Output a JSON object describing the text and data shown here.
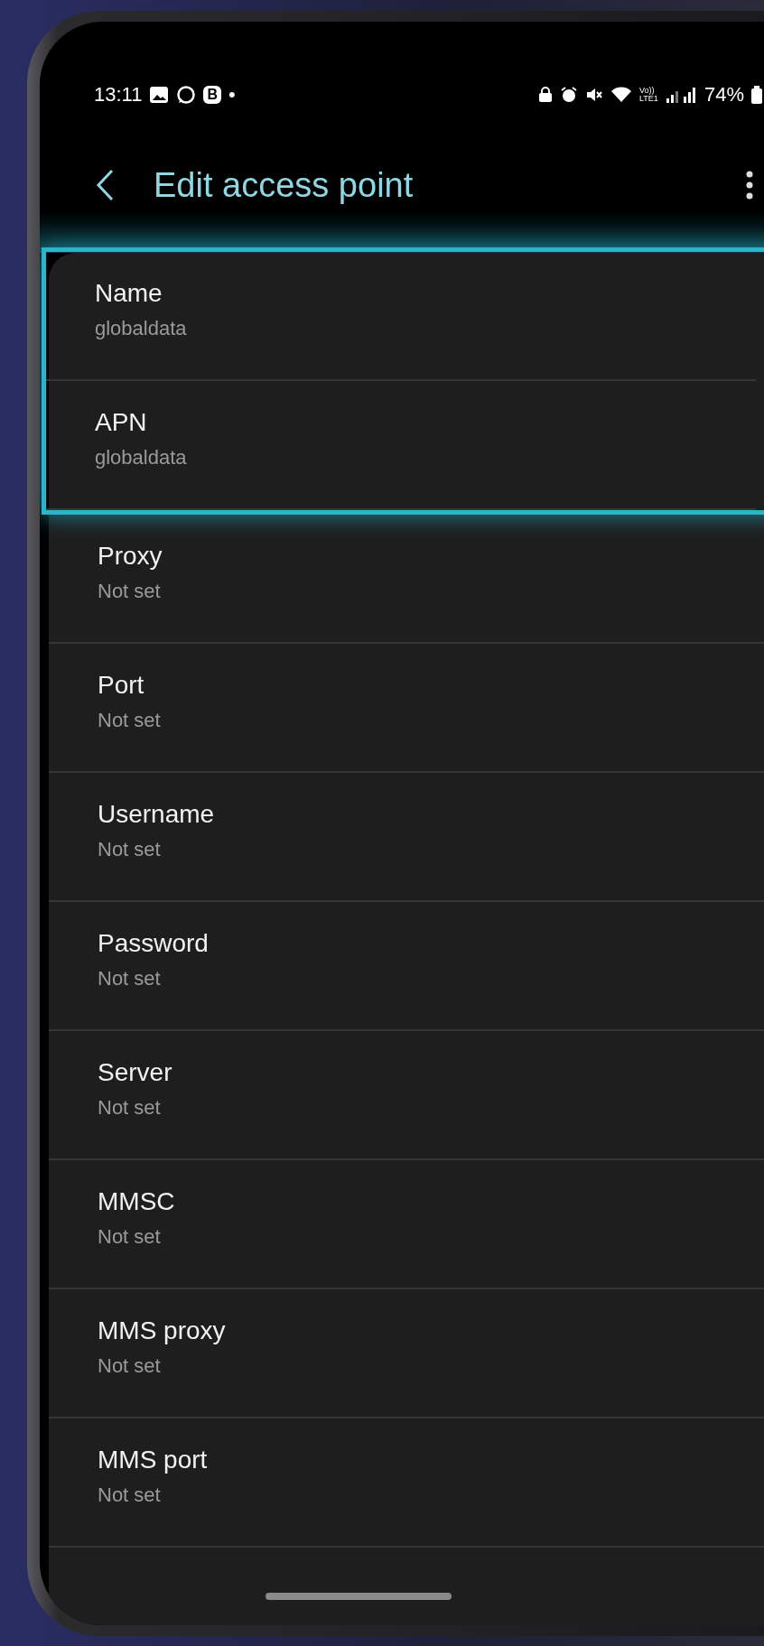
{
  "status_bar": {
    "time": "13:11",
    "badge_letter": "B",
    "more_dot": "•",
    "volte_label": "Vo)) LTE1",
    "battery": "74%"
  },
  "app_bar": {
    "title": "Edit access point"
  },
  "items": [
    {
      "label": "Name",
      "value": "globaldata",
      "highlighted": true
    },
    {
      "label": "APN",
      "value": "globaldata",
      "highlighted": true
    },
    {
      "label": "Proxy",
      "value": "Not set",
      "highlighted": false
    },
    {
      "label": "Port",
      "value": "Not set",
      "highlighted": false
    },
    {
      "label": "Username",
      "value": "Not set",
      "highlighted": false
    },
    {
      "label": "Password",
      "value": "Not set",
      "highlighted": false
    },
    {
      "label": "Server",
      "value": "Not set",
      "highlighted": false
    },
    {
      "label": "MMSC",
      "value": "Not set",
      "highlighted": false
    },
    {
      "label": "MMS proxy",
      "value": "Not set",
      "highlighted": false
    },
    {
      "label": "MMS port",
      "value": "Not set",
      "highlighted": false
    }
  ]
}
